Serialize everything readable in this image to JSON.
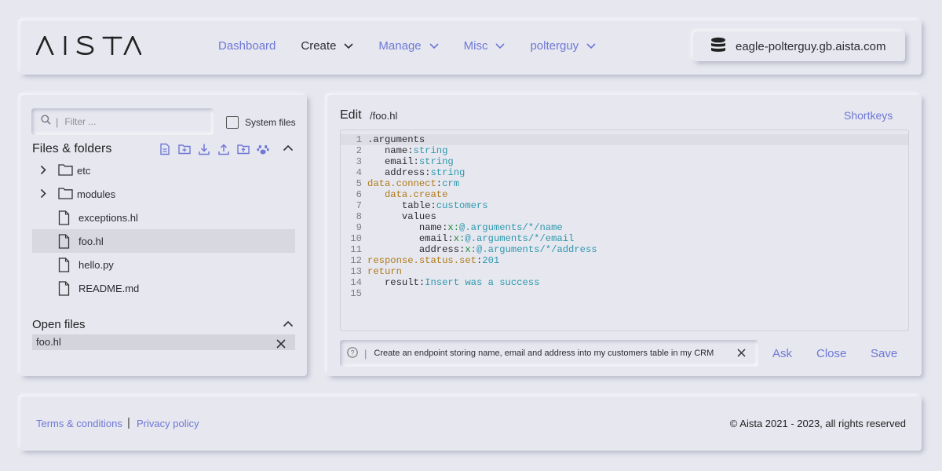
{
  "header": {
    "logo_text": "AISTA",
    "nav": [
      {
        "label": "Dashboard",
        "dropdown": false
      },
      {
        "label": "Create",
        "dropdown": true
      },
      {
        "label": "Manage",
        "dropdown": true
      },
      {
        "label": "Misc",
        "dropdown": true
      },
      {
        "label": "polterguy",
        "dropdown": true
      }
    ],
    "server": "eagle-polterguy.gb.aista.com"
  },
  "files_panel": {
    "filter_placeholder": "Filter ...",
    "system_files_label": "System files",
    "system_files_checked": false,
    "title": "Files & folders",
    "tree": [
      {
        "type": "folder",
        "name": "etc"
      },
      {
        "type": "folder",
        "name": "modules"
      },
      {
        "type": "file",
        "name": "exceptions.hl"
      },
      {
        "type": "file",
        "name": "foo.hl",
        "selected": true
      },
      {
        "type": "file",
        "name": "hello.py"
      },
      {
        "type": "file",
        "name": "README.md"
      }
    ],
    "open_files_title": "Open files",
    "open_files": [
      "foo.hl"
    ]
  },
  "editor": {
    "title": "Edit",
    "path": "/foo.hl",
    "shortkeys_label": "Shortkeys",
    "lines": [
      [
        {
          "t": ".arguments",
          "c": "plain"
        }
      ],
      [
        {
          "t": "   name",
          "c": "plain"
        },
        {
          "t": ":",
          "c": "col"
        },
        {
          "t": "string",
          "c": "val"
        }
      ],
      [
        {
          "t": "   email",
          "c": "plain"
        },
        {
          "t": ":",
          "c": "col"
        },
        {
          "t": "string",
          "c": "val"
        }
      ],
      [
        {
          "t": "   address",
          "c": "plain"
        },
        {
          "t": ":",
          "c": "col"
        },
        {
          "t": "string",
          "c": "val"
        }
      ],
      [
        {
          "t": "data.connect",
          "c": "kw"
        },
        {
          "t": ":",
          "c": "col"
        },
        {
          "t": "crm",
          "c": "val"
        }
      ],
      [
        {
          "t": "   data.create",
          "c": "kw"
        }
      ],
      [
        {
          "t": "      table",
          "c": "plain"
        },
        {
          "t": ":",
          "c": "col"
        },
        {
          "t": "customers",
          "c": "val"
        }
      ],
      [
        {
          "t": "      values",
          "c": "plain"
        }
      ],
      [
        {
          "t": "         name",
          "c": "plain"
        },
        {
          "t": ":",
          "c": "col"
        },
        {
          "t": "x:",
          "c": "x"
        },
        {
          "t": "@.arguments/*/name",
          "c": "val"
        }
      ],
      [
        {
          "t": "         email",
          "c": "plain"
        },
        {
          "t": ":",
          "c": "col"
        },
        {
          "t": "x:",
          "c": "x"
        },
        {
          "t": "@.arguments/*/email",
          "c": "val"
        }
      ],
      [
        {
          "t": "         address",
          "c": "plain"
        },
        {
          "t": ":",
          "c": "col"
        },
        {
          "t": "x:",
          "c": "x"
        },
        {
          "t": "@.arguments/*/address",
          "c": "val"
        }
      ],
      [
        {
          "t": "response.status.set",
          "c": "kw"
        },
        {
          "t": ":",
          "c": "col"
        },
        {
          "t": "201",
          "c": "val"
        }
      ],
      [
        {
          "t": "return",
          "c": "kw"
        }
      ],
      [
        {
          "t": "   result",
          "c": "plain"
        },
        {
          "t": ":",
          "c": "col"
        },
        {
          "t": "Insert was a success",
          "c": "val"
        }
      ],
      []
    ],
    "prompt_value": "Create an endpoint storing name, email and address into my customers table in my CRM",
    "ask_label": "Ask",
    "close_label": "Close",
    "save_label": "Save"
  },
  "footer": {
    "terms": "Terms & conditions",
    "separator": "|",
    "privacy": "Privacy policy",
    "copyright": "© Aista 2021 - 2023, all rights reserved"
  },
  "colors": {
    "background": "#e6e7ef",
    "accent": "#6f78d6",
    "keyword": "#b07a17",
    "value": "#2e98ad",
    "expression": "#1f8a3c"
  }
}
